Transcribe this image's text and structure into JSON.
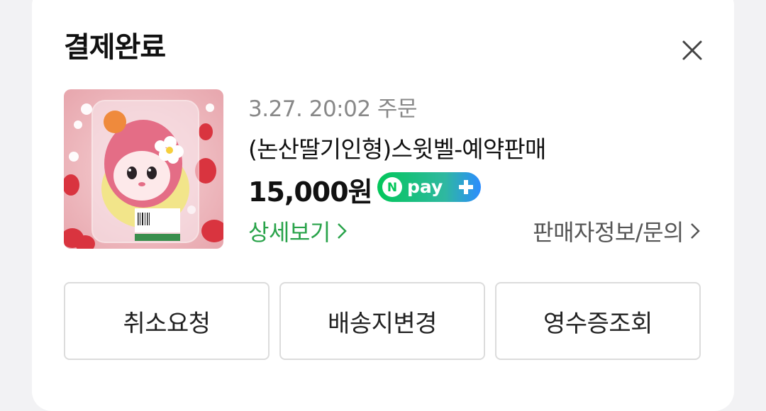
{
  "dialog": {
    "title": "결제완료",
    "close_icon": "close-icon"
  },
  "order": {
    "date": "3.27. 20:02 주문",
    "product_name": "(논산딸기인형)스윗벨-예약판매",
    "price": "15,000원",
    "payment_badge": "npay +",
    "product_image": "strawberry-plush-toy-in-clear-package"
  },
  "links": {
    "detail": "상세보기",
    "seller": "판매자정보/문의"
  },
  "buttons": {
    "cancel": "취소요청",
    "change_address": "배송지변경",
    "receipt": "영수증조회"
  },
  "colors": {
    "accent_green": "#29a34a",
    "npay_green": "#03c75a",
    "npay_blue": "#2b8cff"
  }
}
